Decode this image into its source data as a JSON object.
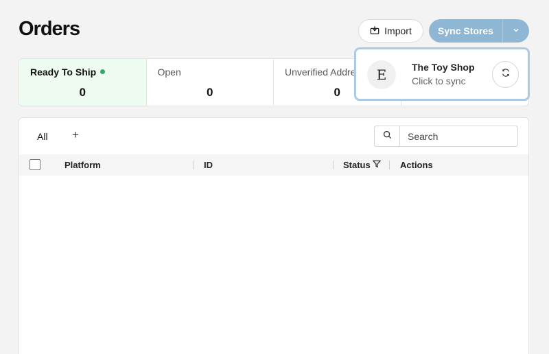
{
  "header": {
    "title": "Orders",
    "import_label": "Import",
    "sync_label": "Sync Stores"
  },
  "stats": [
    {
      "label": "Ready To Ship",
      "value": "0",
      "active": true,
      "indicator_color": "#3aa56a"
    },
    {
      "label": "Open",
      "value": "0"
    },
    {
      "label": "Unverified Addresses",
      "value": "0"
    },
    {
      "label": "",
      "value": ""
    }
  ],
  "sync_popover": {
    "store_logo_letter": "E",
    "store_name": "The Toy Shop",
    "store_subtitle": "Click to sync"
  },
  "orders_table": {
    "tabs": [
      {
        "label": "All"
      }
    ],
    "add_tab_symbol": "+",
    "search_placeholder": "Search",
    "columns": [
      "Platform",
      "ID",
      "Status",
      "Actions"
    ],
    "rows": []
  },
  "colors": {
    "accent": "#8fb6d3",
    "active_stat_bg": "#eefbf0",
    "popover_border": "#a9cbe6"
  }
}
